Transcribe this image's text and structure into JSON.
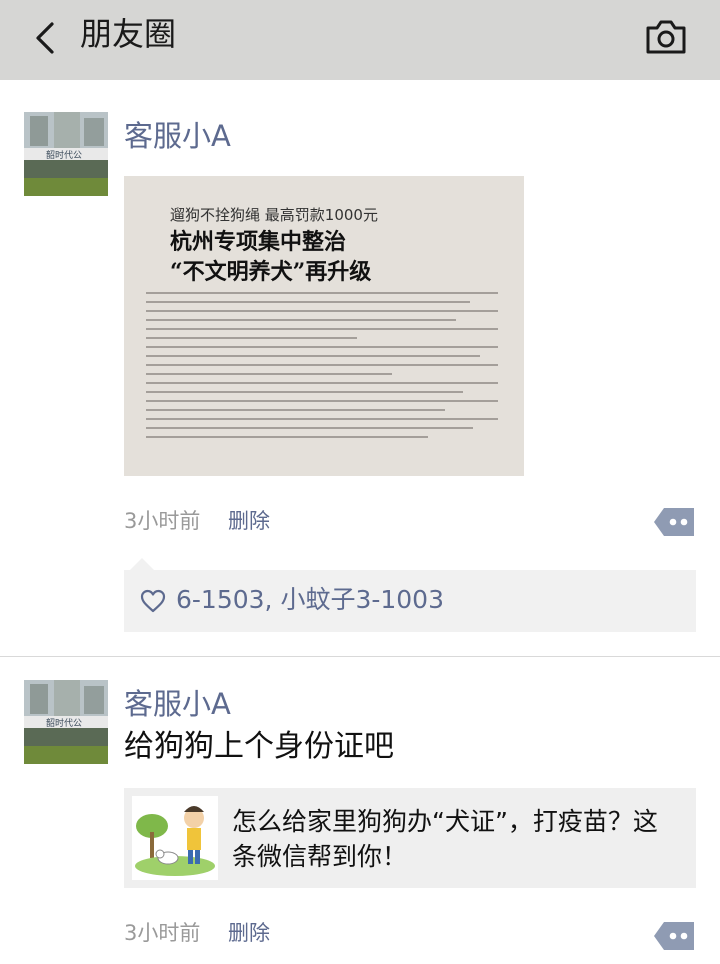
{
  "header": {
    "title": "朋友圈"
  },
  "posts": [
    {
      "author": "客服小A",
      "avatar_sign": "韶时代公",
      "image": {
        "line1": "遛狗不拴狗绳  最高罚款1000元",
        "line2": "杭州专项集中整治",
        "line3": "“不文明养犬”再升级"
      },
      "time": "3小时前",
      "delete_label": "删除",
      "likes": "6-1503, 小蚊子3-1003"
    },
    {
      "author": "客服小A",
      "avatar_sign": "韶时代公",
      "text": "给狗狗上个身份证吧",
      "link_title": "怎么给家里狗狗办“犬证”，打疫苗？这条微信帮到你！",
      "time": "3小时前",
      "delete_label": "删除"
    }
  ],
  "colors": {
    "header_bg": "#d6d6d4",
    "name": "#5d6a8f",
    "meta": "#9a9a9a",
    "likes_bg": "#f1f1f1",
    "more_button": "#8f9bb3"
  },
  "icons": {
    "back": "chevron-left-icon",
    "camera": "camera-icon",
    "like": "heart-icon",
    "more": "more-dots-icon"
  }
}
